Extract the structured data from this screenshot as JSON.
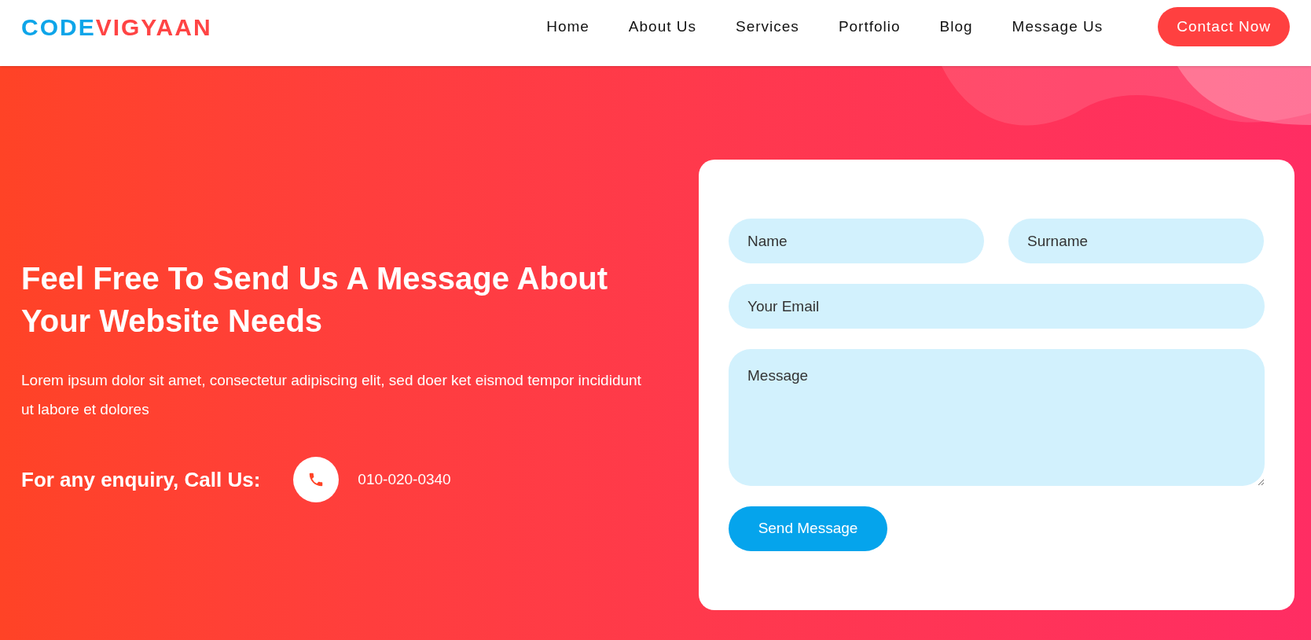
{
  "logo": {
    "parts": [
      {
        "text": "CODE",
        "color": "#0ea5e9"
      },
      {
        "text": "VIGYAAN",
        "color": "#ff4444"
      }
    ]
  },
  "nav": {
    "items": [
      {
        "label": "Home"
      },
      {
        "label": "About Us"
      },
      {
        "label": "Services"
      },
      {
        "label": "Portfolio"
      },
      {
        "label": "Blog"
      },
      {
        "label": "Message Us"
      }
    ],
    "cta": "Contact Now"
  },
  "hero": {
    "heading": "Feel Free To Send Us A Message About Your Website Needs",
    "text": "Lorem ipsum dolor sit amet, consectetur adipiscing elit, sed doer ket eismod tempor incididunt ut labore et dolores",
    "enquiry_label": "For any enquiry, Call Us:",
    "phone": "010-020-0340"
  },
  "form": {
    "fields": [
      {
        "kind": "input",
        "placeholder": "Name"
      },
      {
        "kind": "input",
        "placeholder": "Surname"
      },
      {
        "kind": "input",
        "placeholder": "Your Email"
      },
      {
        "kind": "textarea",
        "placeholder": "Message"
      }
    ],
    "submit": "Send Message"
  }
}
